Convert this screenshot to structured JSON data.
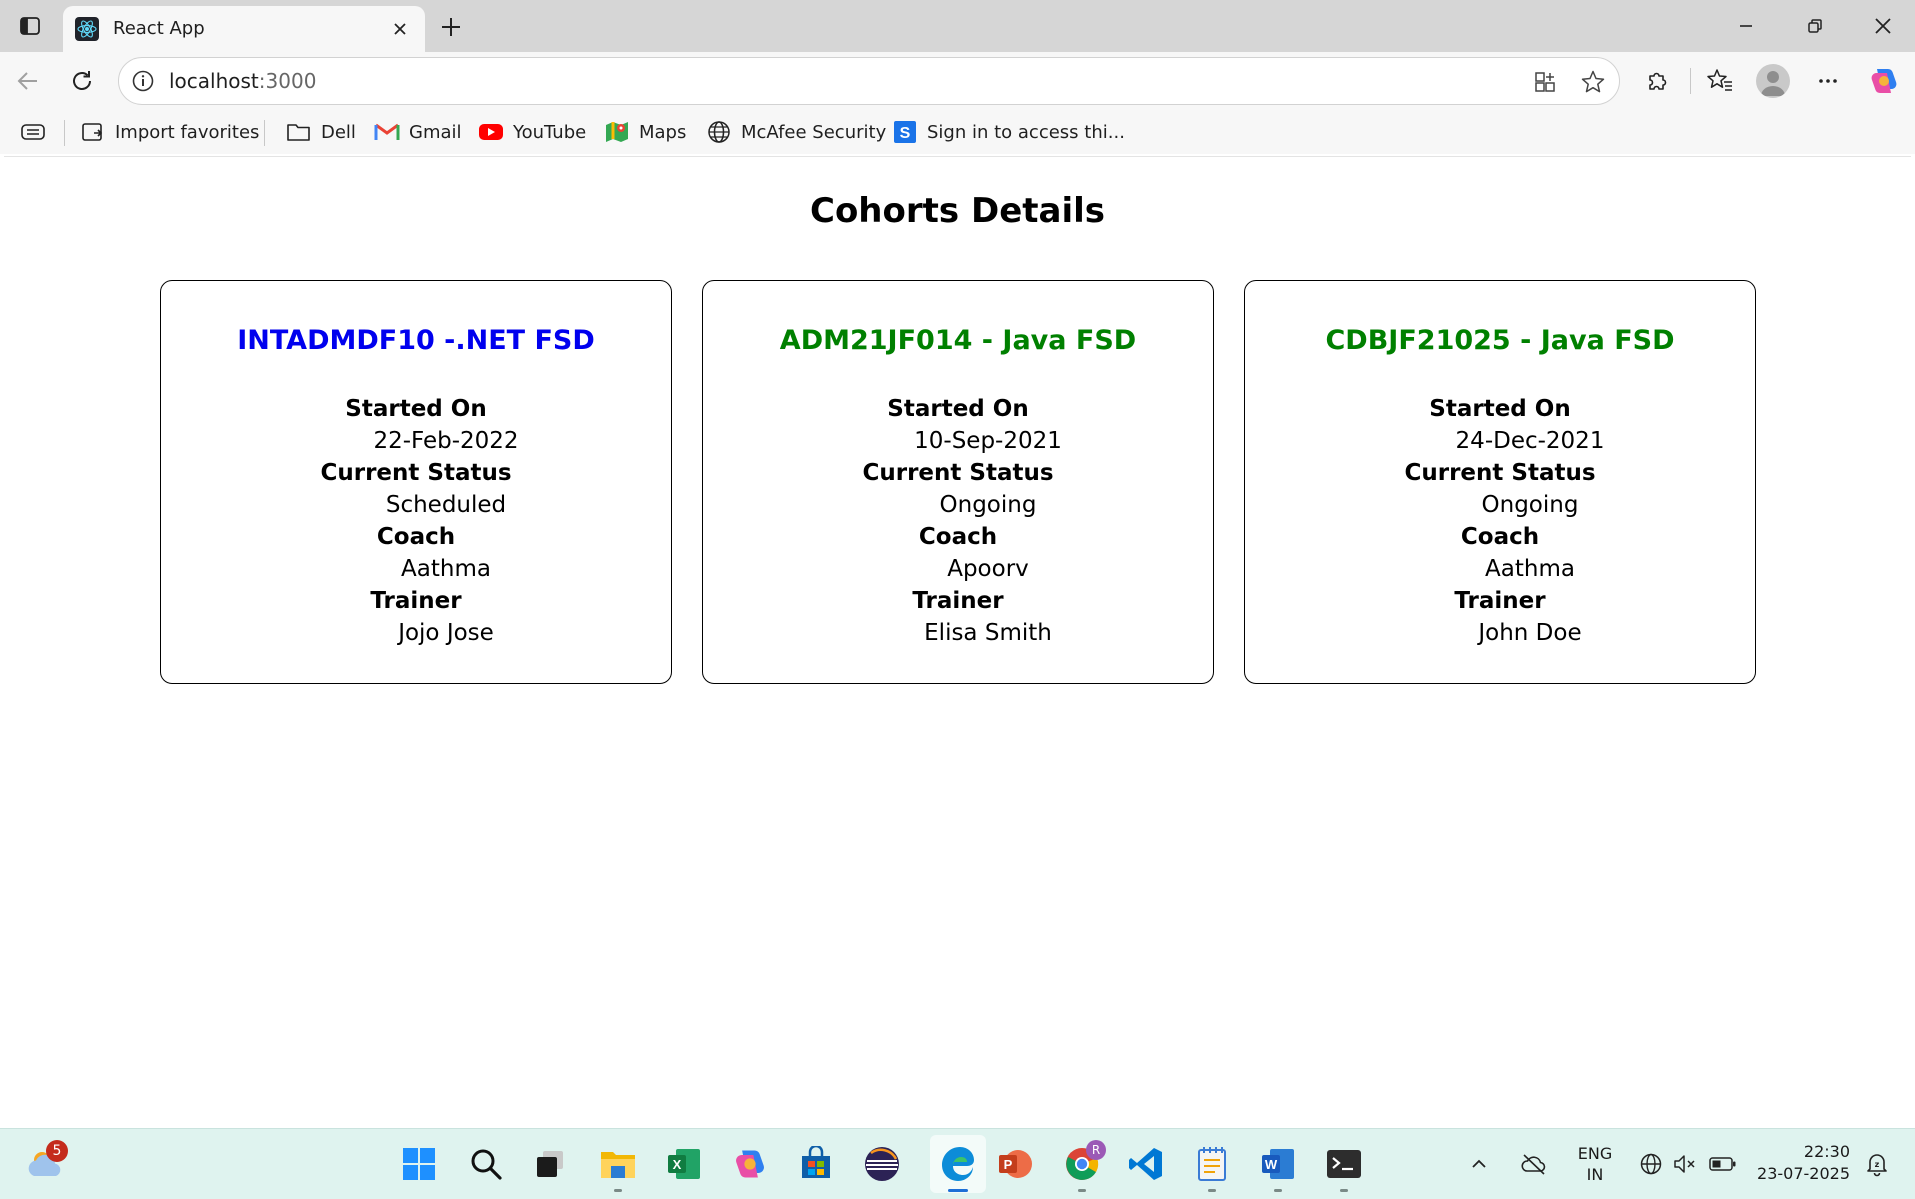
{
  "browser": {
    "tab": {
      "title": "React App"
    },
    "address": {
      "host": "localhost",
      "port": ":3000"
    },
    "favorites": [
      {
        "label": "Import favorites",
        "icon": "import-favorites-icon"
      },
      {
        "label": "Dell",
        "icon": "folder-icon"
      },
      {
        "label": "Gmail",
        "icon": "gmail-icon"
      },
      {
        "label": "YouTube",
        "icon": "youtube-icon"
      },
      {
        "label": "Maps",
        "icon": "maps-icon"
      },
      {
        "label": "McAfee Security",
        "icon": "globe-icon"
      },
      {
        "label": "Sign in to access thi...",
        "icon": "sign-in-icon"
      }
    ]
  },
  "page": {
    "title": "Cohorts Details",
    "colors": {
      "scheduled": "#0000ee",
      "ongoing": "#008000"
    },
    "labels": {
      "started_on": "Started On",
      "current_status": "Current Status",
      "coach": "Coach",
      "trainer": "Trainer"
    },
    "cohorts": [
      {
        "name": "INTADMDF10 -.NET FSD",
        "started_on": "22-Feb-2022",
        "status": "Scheduled",
        "coach": "Aathma",
        "trainer": "Jojo Jose",
        "title_color": "#0000ee"
      },
      {
        "name": "ADM21JF014 - Java FSD",
        "started_on": "10-Sep-2021",
        "status": "Ongoing",
        "coach": "Apoorv",
        "trainer": "Elisa Smith",
        "title_color": "#008000"
      },
      {
        "name": "CDBJF21025 - Java FSD",
        "started_on": "24-Dec-2021",
        "status": "Ongoing",
        "coach": "Aathma",
        "trainer": "John Doe",
        "title_color": "#008000"
      }
    ]
  },
  "taskbar": {
    "weather_badge": "5",
    "language": {
      "line1": "ENG",
      "line2": "IN"
    },
    "clock": {
      "time": "22:30",
      "date": "23-07-2025"
    },
    "chrome_profile_badge": "R"
  }
}
